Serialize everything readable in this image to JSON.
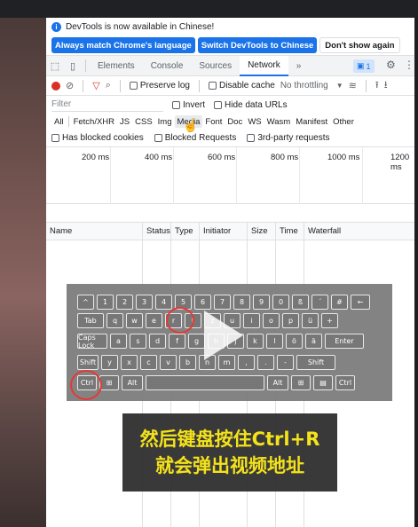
{
  "infobar": {
    "message": "DevTools is now available in Chinese!",
    "btn_match": "Always match Chrome's language",
    "btn_switch": "Switch DevTools to Chinese",
    "btn_dismiss": "Don't show again"
  },
  "tabs": [
    "Elements",
    "Console",
    "Sources",
    "Network"
  ],
  "tabs_more": "»",
  "issues_count": "1",
  "toolbar": {
    "preserve_log": "Preserve log",
    "disable_cache": "Disable cache",
    "throttling": "No throttling"
  },
  "filter": {
    "placeholder": "Filter",
    "invert": "Invert",
    "hide_data_urls": "Hide data URLs"
  },
  "types": [
    "All",
    "Fetch/XHR",
    "JS",
    "CSS",
    "Img",
    "Media",
    "Font",
    "Doc",
    "WS",
    "Wasm",
    "Manifest",
    "Other"
  ],
  "blocked": {
    "has_blocked_cookies": "Has blocked cookies",
    "blocked_requests": "Blocked Requests",
    "third_party": "3rd-party requests"
  },
  "timeline_ticks": [
    "200 ms",
    "400 ms",
    "600 ms",
    "800 ms",
    "1000 ms",
    "1200 ms"
  ],
  "columns": [
    "Name",
    "Status",
    "Type",
    "Initiator",
    "Size",
    "Time",
    "Waterfall"
  ],
  "keyboard": {
    "row1": [
      "^",
      "1",
      "2",
      "3",
      "4",
      "5",
      "6",
      "7",
      "8",
      "9",
      "0",
      "ß",
      "´",
      "#",
      "←"
    ],
    "row2": [
      "Tab",
      "q",
      "w",
      "e",
      "r",
      "t",
      "z",
      "u",
      "i",
      "o",
      "p",
      "ü",
      "+"
    ],
    "row3": [
      "Caps Lock",
      "a",
      "s",
      "d",
      "f",
      "g",
      "h",
      "j",
      "k",
      "l",
      "ö",
      "ä",
      "Enter"
    ],
    "row4": [
      "Shift",
      "y",
      "x",
      "c",
      "v",
      "b",
      "n",
      "m",
      ",",
      ".",
      "-",
      "Shift"
    ],
    "row5": [
      "Ctrl",
      "⊞",
      "Alt",
      "",
      "Alt",
      "⊞",
      "▤",
      "Ctrl"
    ]
  },
  "caption": {
    "line1": "然后键盘按住Ctrl+R",
    "line2": "就会弹出视频地址"
  },
  "colors": {
    "accent": "#1a73e8",
    "record": "#d93025",
    "caption_text": "#f4e21b",
    "highlight_circle": "#e53935"
  }
}
